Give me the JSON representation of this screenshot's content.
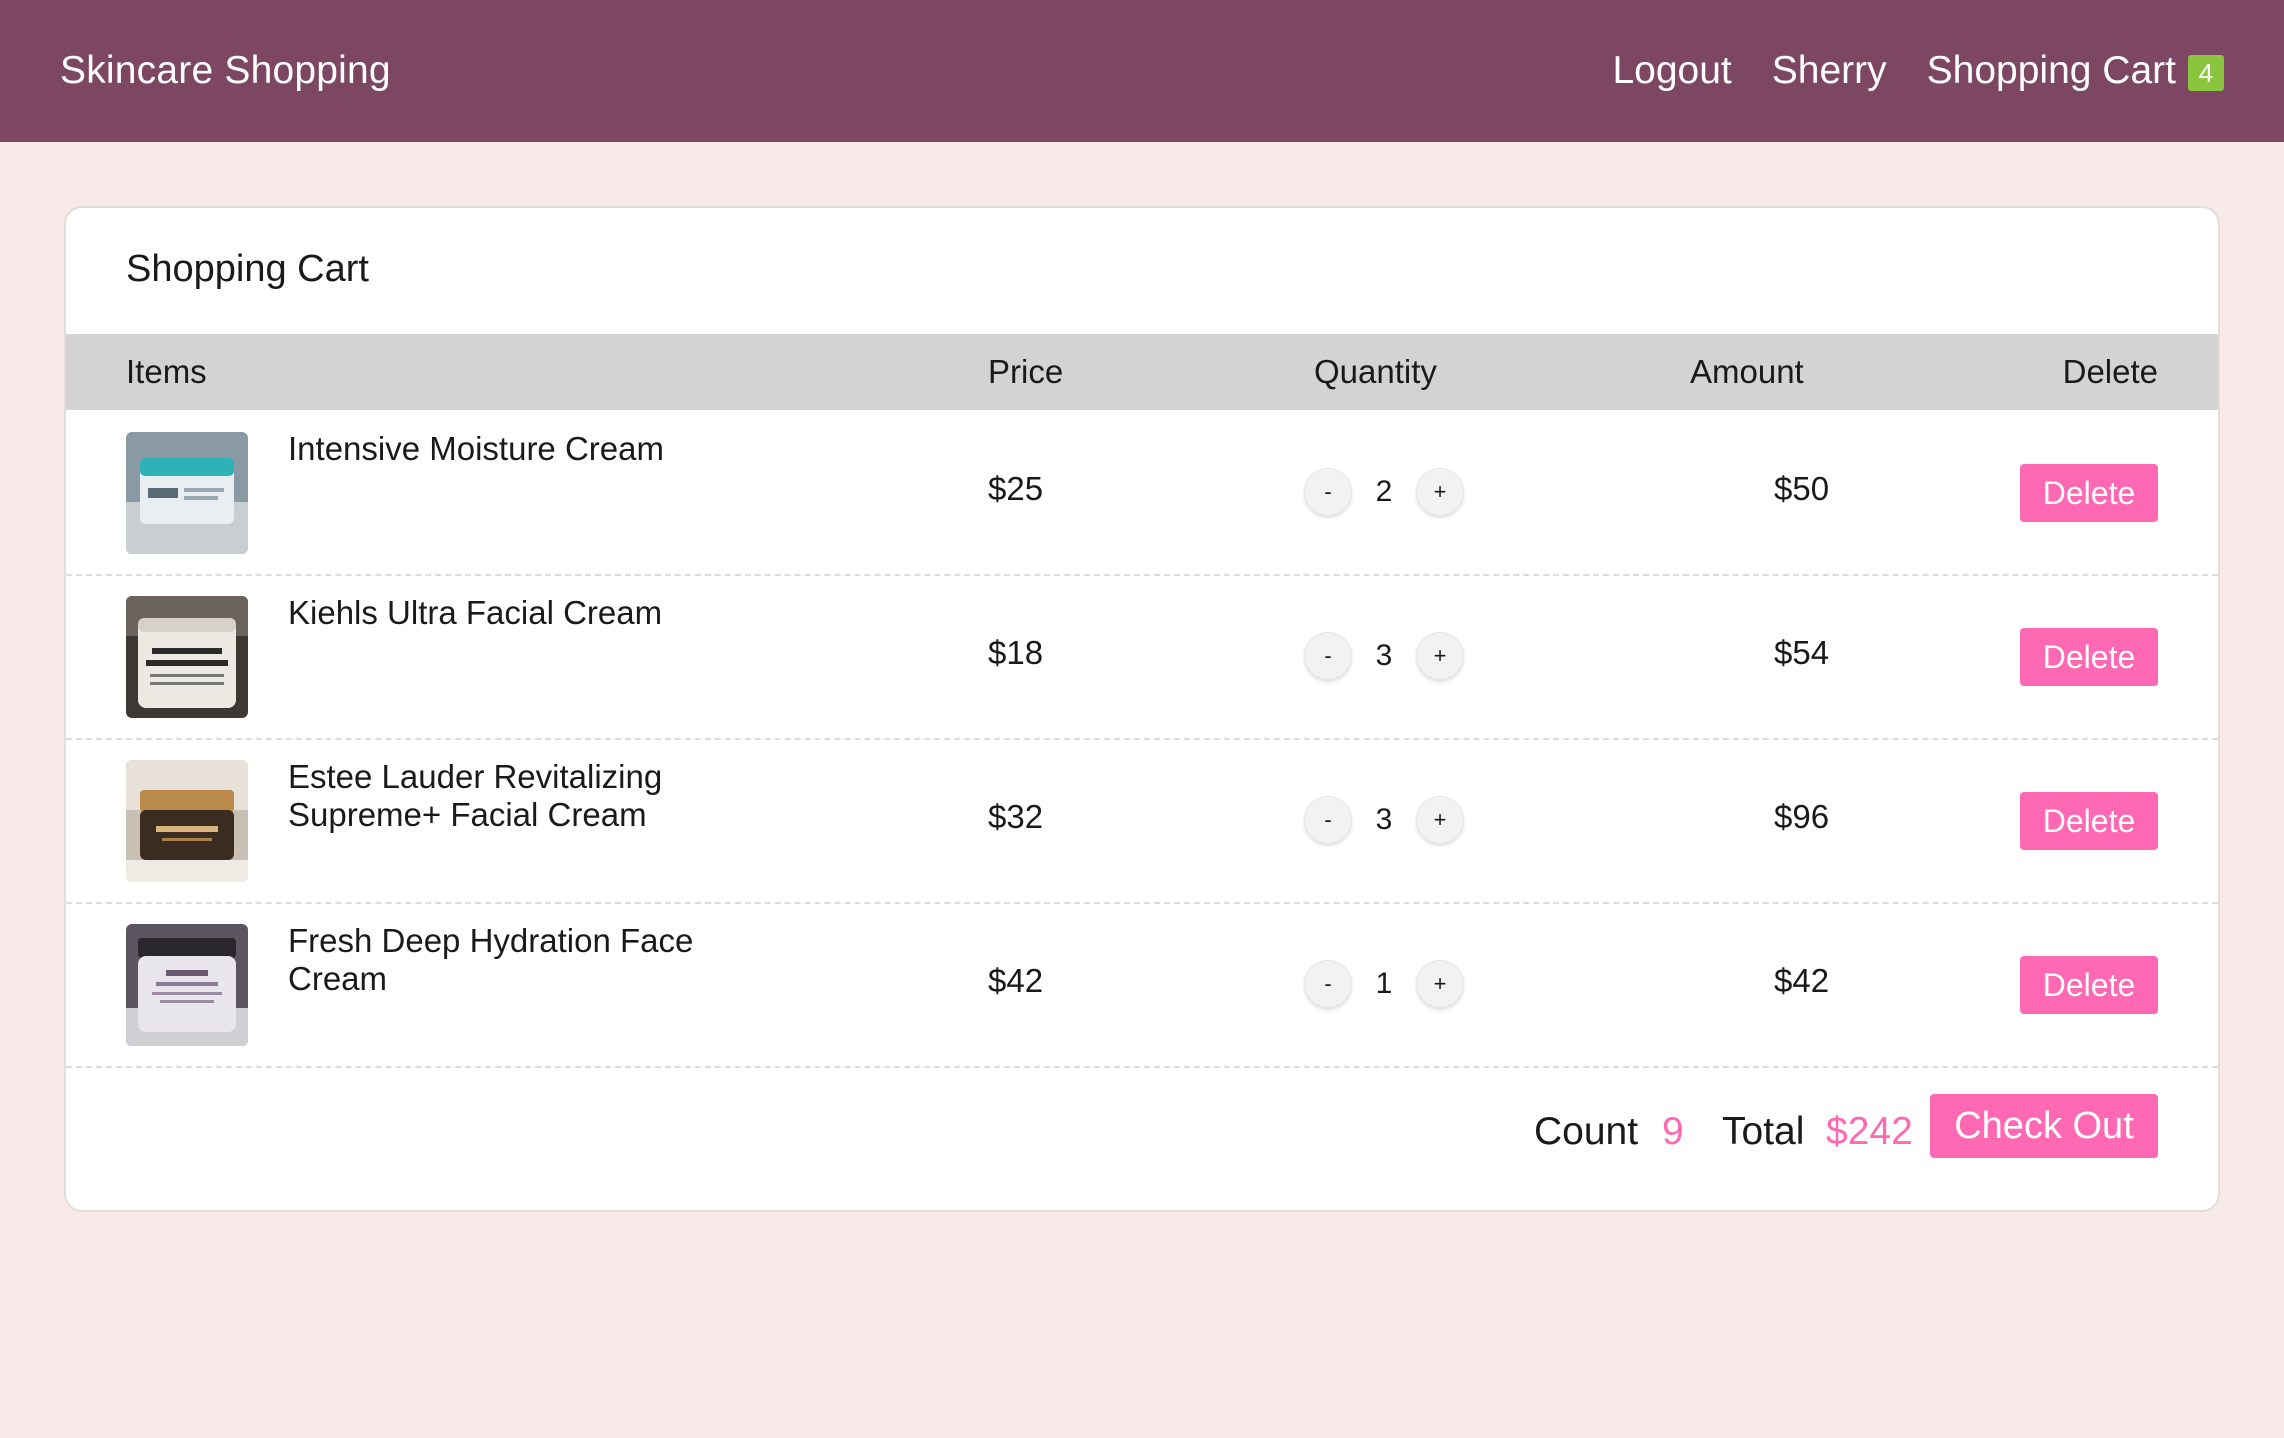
{
  "navbar": {
    "brand": "Skincare Shopping",
    "logout": "Logout",
    "user": "Sherry",
    "cart_label": "Shopping Cart",
    "cart_count": "4"
  },
  "cart": {
    "title": "Shopping Cart",
    "headers": {
      "items": "Items",
      "price": "Price",
      "quantity": "Quantity",
      "amount": "Amount",
      "delete": "Delete"
    },
    "rows": [
      {
        "name": "Intensive Moisture Cream",
        "price": "$25",
        "qty": "2",
        "amount": "$50",
        "delete": "Delete",
        "minus": "-",
        "plus": "+"
      },
      {
        "name": "Kiehls Ultra Facial Cream",
        "price": "$18",
        "qty": "3",
        "amount": "$54",
        "delete": "Delete",
        "minus": "-",
        "plus": "+"
      },
      {
        "name": "Estee Lauder Revitalizing Supreme+ Facial Cream",
        "price": "$32",
        "qty": "3",
        "amount": "$96",
        "delete": "Delete",
        "minus": "-",
        "plus": "+"
      },
      {
        "name": "Fresh Deep Hydration Face Cream",
        "price": "$42",
        "qty": "1",
        "amount": "$42",
        "delete": "Delete",
        "minus": "-",
        "plus": "+"
      }
    ],
    "footer": {
      "count_label": "Count",
      "count": "9",
      "total_label": "Total",
      "total": "$242",
      "checkout": "Check Out"
    }
  },
  "colors": {
    "navbar": "#7d4662",
    "background": "#f8eaea",
    "accent_pink": "#ff69b4",
    "badge_green": "#8bc53f",
    "table_header": "#d3d3d3"
  }
}
